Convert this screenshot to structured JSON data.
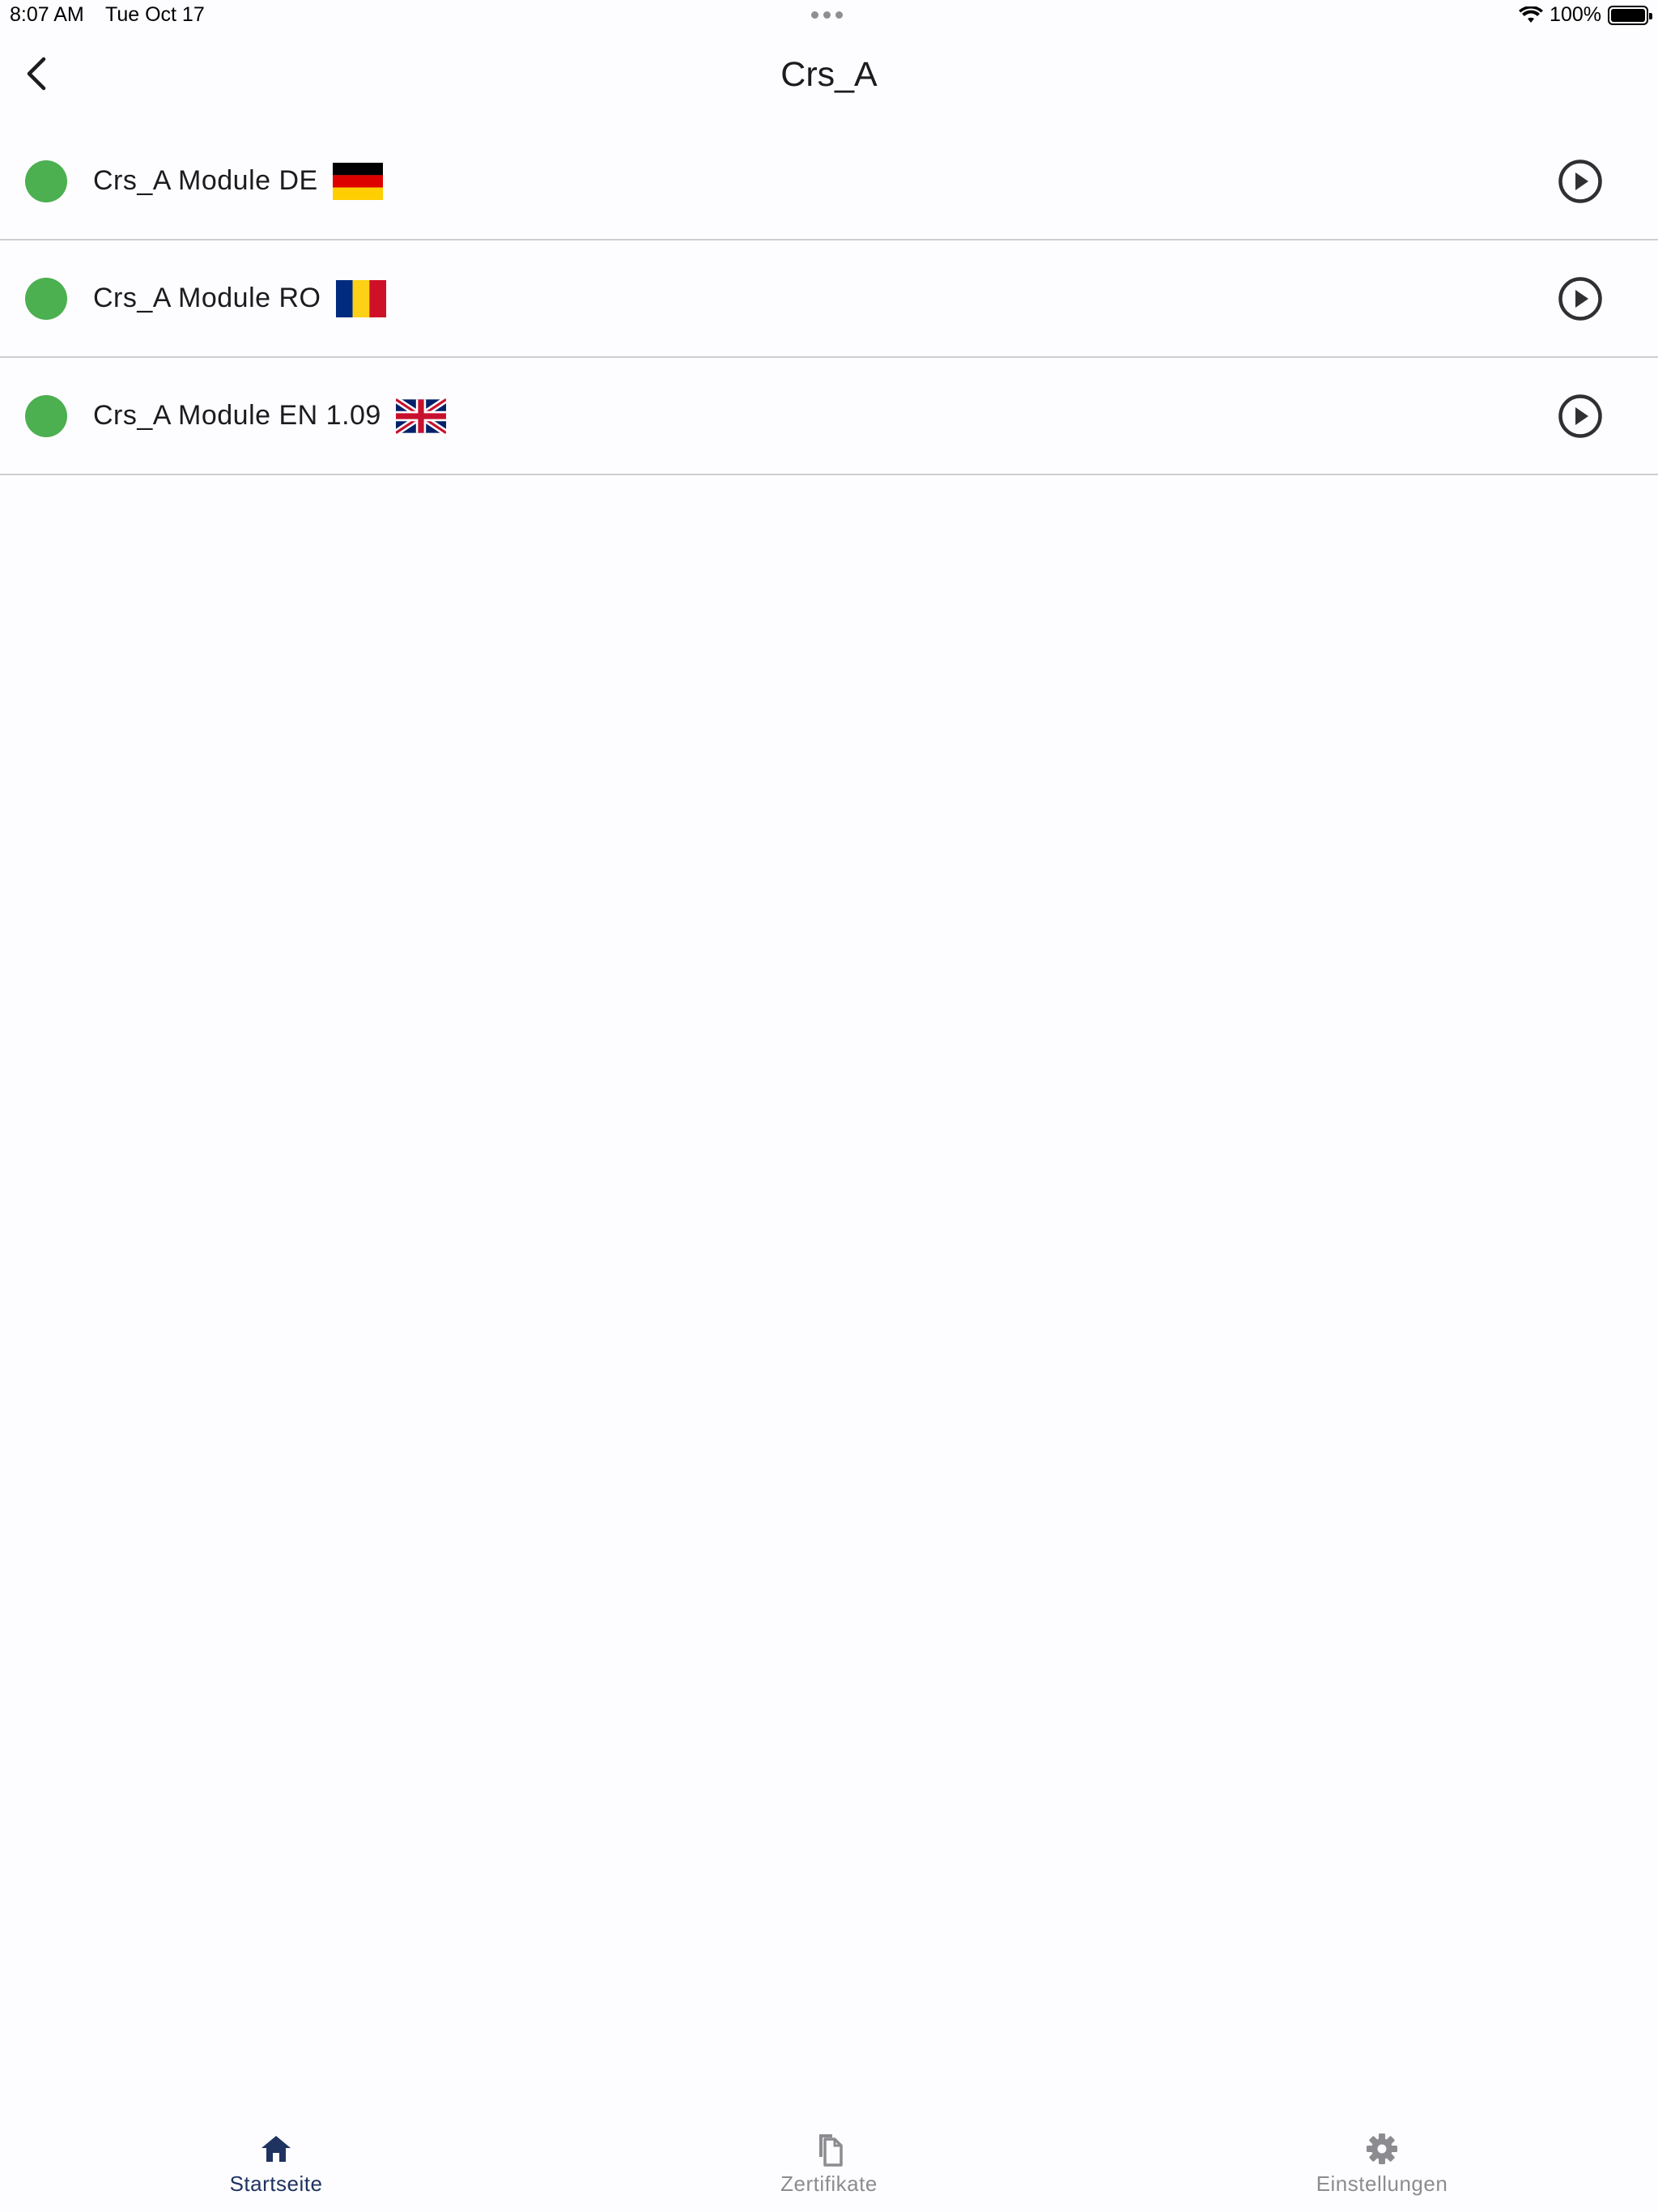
{
  "status_bar": {
    "time": "8:07 AM",
    "date": "Tue Oct 17",
    "battery": "100%"
  },
  "header": {
    "title": "Crs_A"
  },
  "modules": [
    {
      "label": "Crs_A Module DE",
      "flag": "flag-de-icon"
    },
    {
      "label": "Crs_A Module RO",
      "flag": "flag-ro-icon"
    },
    {
      "label": "Crs_A Module EN 1.09",
      "flag": "flag-uk-icon"
    }
  ],
  "bottom_nav": {
    "items": [
      {
        "label": "Startseite",
        "icon": "home-icon",
        "active": true
      },
      {
        "label": "Zertifikate",
        "icon": "documents-icon",
        "active": false
      },
      {
        "label": "Einstellungen",
        "icon": "gear-icon",
        "active": false
      }
    ]
  },
  "colors": {
    "status_complete": "#4caf50",
    "active_tab": "#1f3361",
    "inactive_tab": "#8c8c90"
  }
}
